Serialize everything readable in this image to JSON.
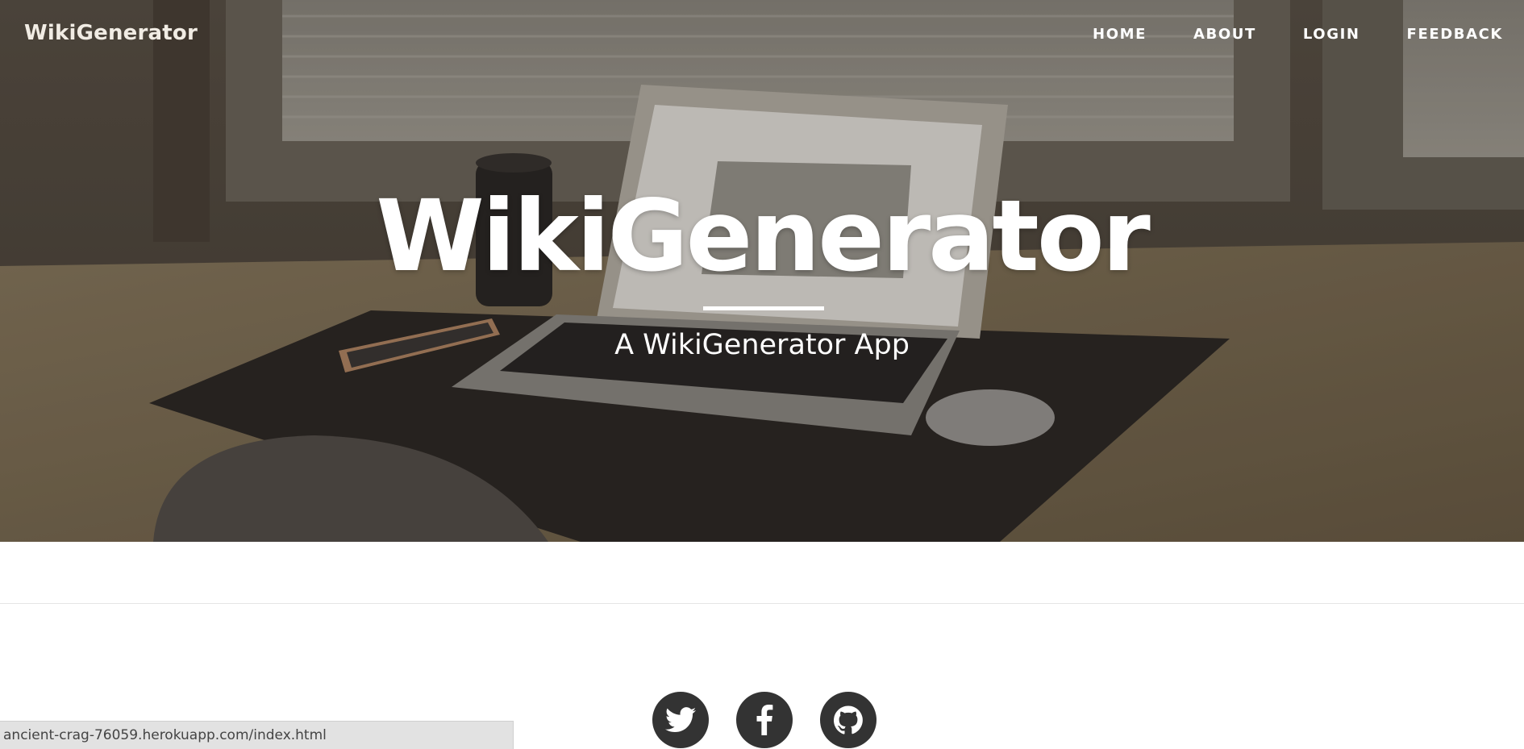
{
  "nav": {
    "brand": "WikiGenerator",
    "links": [
      "HOME",
      "ABOUT",
      "LOGIN",
      "FEEDBACK"
    ]
  },
  "hero": {
    "title": "WikiGenerator",
    "subtitle": "A WikiGenerator App",
    "background": "desk-with-laptop-photo",
    "overlay_color": "#000000"
  },
  "social": {
    "icons": [
      "twitter-icon",
      "facebook-icon",
      "github-icon"
    ],
    "button_color": "#333333"
  },
  "status_bar": {
    "url": "ancient-crag-76059.herokuapp.com/index.html"
  }
}
